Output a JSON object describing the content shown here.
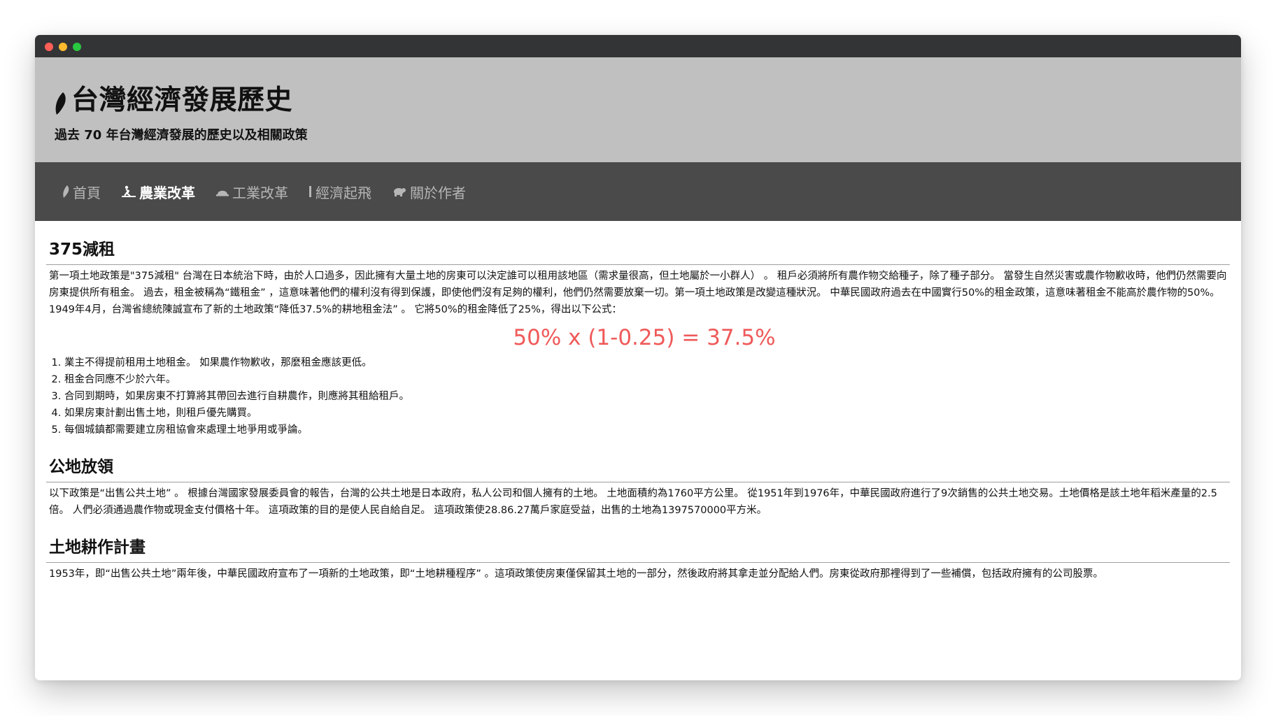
{
  "site": {
    "title": "台灣經濟發展歷史",
    "subtitle": "過去 70 年台灣經濟發展的歷史以及相關政策"
  },
  "nav": {
    "items": [
      {
        "label": "首頁",
        "icon": "taiwan-leaf-icon",
        "active": false
      },
      {
        "label": "農業改革",
        "icon": "farmer-icon",
        "active": true
      },
      {
        "label": "工業改革",
        "icon": "helmet-icon",
        "active": false
      },
      {
        "label": "經濟起飛",
        "icon": "bar-icon",
        "active": false
      },
      {
        "label": "關於作者",
        "icon": "bear-icon",
        "active": false
      }
    ]
  },
  "colors": {
    "header_bg": "#c0c0c0",
    "nav_bg": "#4a4a4a",
    "formula": "#ef5a5a"
  },
  "sections": [
    {
      "heading": "375減租",
      "paragraph": "第一項土地政策是\"375減租\" 台灣在日本統治下時，由於人口過多，因此擁有大量土地的房東可以決定誰可以租用該地區（需求量很高，但土地屬於一小群人） 。 租戶必須將所有農作物交給種子，除了種子部分。 當發生自然災害或農作物歉收時，他們仍然需要向房東提供所有租金。 過去，租金被稱為“鐵租金” ，這意味著他們的權利沒有得到保護，即使他們沒有足夠的權利，他們仍然需要放棄一切。第一項土地政策是改變這種狀況。 中華民國政府過去在中國實行50%的租金政策，這意味著租金不能高於農作物的50%。 1949年4月，台灣省總統陳誠宣布了新的土地政策“降低37.5%的耕地租金法” 。 它將50%的租金降低了25%，得出以下公式：",
      "formula": "50% x (1-0.25) = 37.5%",
      "rules": [
        "業主不得提前租用土地租金。 如果農作物歉收，那麼租金應該更低。",
        "租金合同應不少於六年。",
        "合同到期時，如果房東不打算將其帶回去進行自耕農作，則應將其租給租戶。",
        "如果房東計劃出售土地，則租戶優先購買。",
        "每個城鎮都需要建立房租協會來處理土地爭用或爭論。"
      ]
    },
    {
      "heading": "公地放領",
      "paragraph": "以下政策是“出售公共土地” 。 根據台灣國家發展委員會的報告，台灣的公共土地是日本政府，私人公司和個人擁有的土地。 土地面積約為1760平方公里。 從1951年到1976年，中華民國政府進行了9次銷售的公共土地交易。土地價格是該土地年稻米產量的2.5倍。 人們必須通過農作物或現金支付價格十年。 這項政策的目的是使人民自給自足。 這項政策使28.86.27萬戶家庭受益，出售的土地為1397570000平方米。"
    },
    {
      "heading": "土地耕作計畫",
      "paragraph": "1953年，即“出售公共土地”兩年後，中華民國政府宣布了一項新的土地政策，即“土地耕種程序” 。這項政策使房東僅保留其土地的一部分，然後政府將其拿走並分配給人們。房東從政府那裡得到了一些補償，包括政府擁有的公司股票。"
    }
  ]
}
